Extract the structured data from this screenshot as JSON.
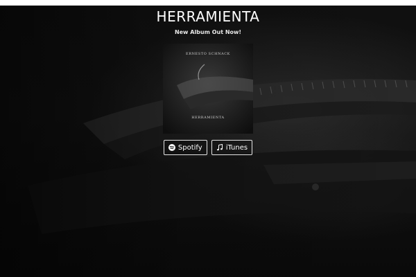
{
  "header": {
    "title": "HERRAMIENTA",
    "subtitle": "New Album Out Now!"
  },
  "album": {
    "artist": "ERNESTO SCHNACK",
    "title": "HERRAMIENTA"
  },
  "links": [
    {
      "label": "Spotify",
      "icon": "spotify-icon"
    },
    {
      "label": "iTunes",
      "icon": "music-note-icon"
    }
  ],
  "colors": {
    "background": "#0d0d0d",
    "text": "#ffffff",
    "button_border": "#e6e6e6"
  }
}
